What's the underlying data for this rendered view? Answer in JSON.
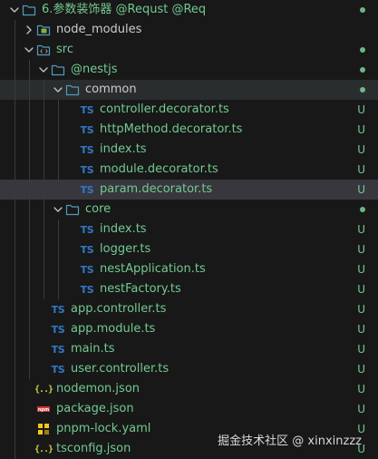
{
  "colors": {
    "background": "#181818",
    "text": "#cccccc",
    "git_untracked": "#73c991",
    "ts_icon": "#3178c6",
    "folder_icon": "#519aba",
    "json_icon": "#cbcb41",
    "npm_icon": "#cb3837",
    "yaml_icon": "#f3c61b",
    "selected_row": "#37373d",
    "hover_row": "#2a2d2e"
  },
  "tree": [
    {
      "id": "root",
      "label": "6.参数装饰器 @Requst @Req",
      "depth": 0,
      "type": "folder",
      "expanded": true,
      "icon": "folder-icon",
      "status": "dot",
      "git": "untracked"
    },
    {
      "id": "node_modules",
      "label": "node_modules",
      "depth": 1,
      "type": "folder",
      "expanded": false,
      "icon": "folder-node-icon",
      "status": "",
      "git": "none"
    },
    {
      "id": "src",
      "label": "src",
      "depth": 1,
      "type": "folder",
      "expanded": true,
      "icon": "folder-src-icon",
      "status": "dot",
      "git": "untracked"
    },
    {
      "id": "nestjs",
      "label": "@nestjs",
      "depth": 2,
      "type": "folder",
      "expanded": true,
      "icon": "folder-icon",
      "status": "dot",
      "git": "untracked"
    },
    {
      "id": "common",
      "label": "common",
      "depth": 3,
      "type": "folder",
      "expanded": true,
      "icon": "folder-icon",
      "status": "dot",
      "git": "plain",
      "row": "hover"
    },
    {
      "id": "controller_decorator",
      "label": "controller.decorator.ts",
      "depth": 4,
      "type": "ts",
      "icon": "typescript-icon",
      "status": "U",
      "git": "untracked"
    },
    {
      "id": "httpMethod_decorator",
      "label": "httpMethod.decorator.ts",
      "depth": 4,
      "type": "ts",
      "icon": "typescript-icon",
      "status": "U",
      "git": "untracked"
    },
    {
      "id": "common_index",
      "label": "index.ts",
      "depth": 4,
      "type": "ts",
      "icon": "typescript-icon",
      "status": "U",
      "git": "untracked"
    },
    {
      "id": "module_decorator",
      "label": "module.decorator.ts",
      "depth": 4,
      "type": "ts",
      "icon": "typescript-icon",
      "status": "U",
      "git": "untracked"
    },
    {
      "id": "param_decorator",
      "label": "param.decorator.ts",
      "depth": 4,
      "type": "ts",
      "icon": "typescript-icon",
      "status": "U",
      "git": "untracked",
      "row": "selected"
    },
    {
      "id": "core",
      "label": "core",
      "depth": 3,
      "type": "folder",
      "expanded": true,
      "icon": "folder-icon",
      "status": "dot",
      "git": "untracked"
    },
    {
      "id": "core_index",
      "label": "index.ts",
      "depth": 4,
      "type": "ts",
      "icon": "typescript-icon",
      "status": "U",
      "git": "untracked"
    },
    {
      "id": "logger",
      "label": "logger.ts",
      "depth": 4,
      "type": "ts",
      "icon": "typescript-icon",
      "status": "U",
      "git": "untracked"
    },
    {
      "id": "nestApplication",
      "label": "nestApplication.ts",
      "depth": 4,
      "type": "ts",
      "icon": "typescript-icon",
      "status": "U",
      "git": "untracked"
    },
    {
      "id": "nestFactory",
      "label": "nestFactory.ts",
      "depth": 4,
      "type": "ts",
      "icon": "typescript-icon",
      "status": "U",
      "git": "untracked"
    },
    {
      "id": "app_controller",
      "label": "app.controller.ts",
      "depth": 2,
      "type": "ts",
      "icon": "typescript-icon",
      "status": "U",
      "git": "untracked"
    },
    {
      "id": "app_module",
      "label": "app.module.ts",
      "depth": 2,
      "type": "ts",
      "icon": "typescript-icon",
      "status": "U",
      "git": "untracked"
    },
    {
      "id": "main",
      "label": "main.ts",
      "depth": 2,
      "type": "ts",
      "icon": "typescript-icon",
      "status": "U",
      "git": "untracked"
    },
    {
      "id": "user_controller",
      "label": "user.controller.ts",
      "depth": 2,
      "type": "ts",
      "icon": "typescript-icon",
      "status": "U",
      "git": "untracked"
    },
    {
      "id": "nodemon",
      "label": "nodemon.json",
      "depth": 1,
      "type": "json",
      "icon": "json-icon",
      "status": "U",
      "git": "untracked"
    },
    {
      "id": "package",
      "label": "package.json",
      "depth": 1,
      "type": "npm",
      "icon": "npm-icon",
      "status": "U",
      "git": "untracked"
    },
    {
      "id": "pnpm_lock",
      "label": "pnpm-lock.yaml",
      "depth": 1,
      "type": "yaml",
      "icon": "yaml-icon",
      "status": "U",
      "git": "untracked"
    },
    {
      "id": "tsconfig",
      "label": "tsconfig.json",
      "depth": 1,
      "type": "json",
      "icon": "json-icon",
      "status": "U",
      "git": "untracked"
    }
  ],
  "icon_text": {
    "typescript": "TS",
    "json": "{..}",
    "npm": "npm"
  },
  "watermark": "掘金技术社区 @ xinxinzzz"
}
